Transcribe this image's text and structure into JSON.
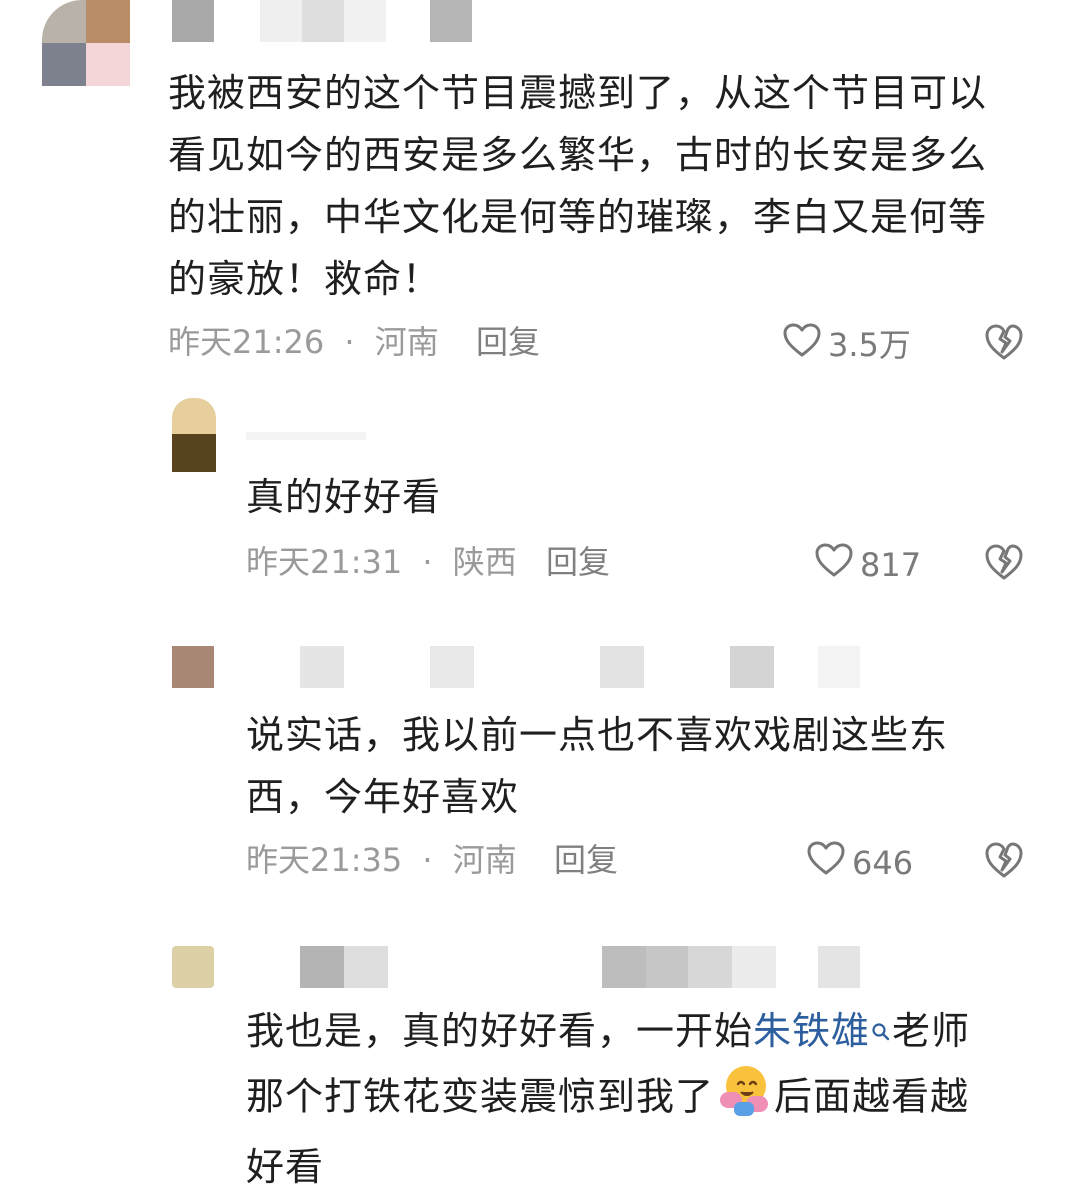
{
  "comments": [
    {
      "text_lines": [
        "我被西安的这个节目震撼到了，从这个节目可以",
        "看见如今的西安是多么繁华，古时的长安是多么",
        "的壮丽，中华文化是何等的璀璨，李白又是何等",
        "的豪放！救命！"
      ],
      "time": "昨天21:26",
      "sep": "·",
      "location": "河南",
      "reply": "回复",
      "likes": "3.5万"
    },
    {
      "text_lines": [
        "真的好好看"
      ],
      "time": "昨天21:31",
      "sep": "·",
      "location": "陕西",
      "reply": "回复",
      "likes": "817"
    },
    {
      "text_lines": [
        "说实话，我以前一点也不喜欢戏剧这些东",
        "西，今年好喜欢"
      ],
      "time": "昨天21:35",
      "sep": "·",
      "location": "河南",
      "reply": "回复",
      "likes": "646"
    },
    {
      "line1_before": "我也是，真的好好看，一开始",
      "line1_link": "朱铁雄",
      "line1_after": "老师",
      "line2_before": "那个打铁花变装震惊到我了",
      "line2_after": "后面越看越",
      "line3": "好看"
    }
  ],
  "icons": {
    "like": "heart-outline-icon",
    "dislike": "broken-heart-icon",
    "search": "search-icon",
    "emoji": "hugging-face-emoji-icon"
  }
}
